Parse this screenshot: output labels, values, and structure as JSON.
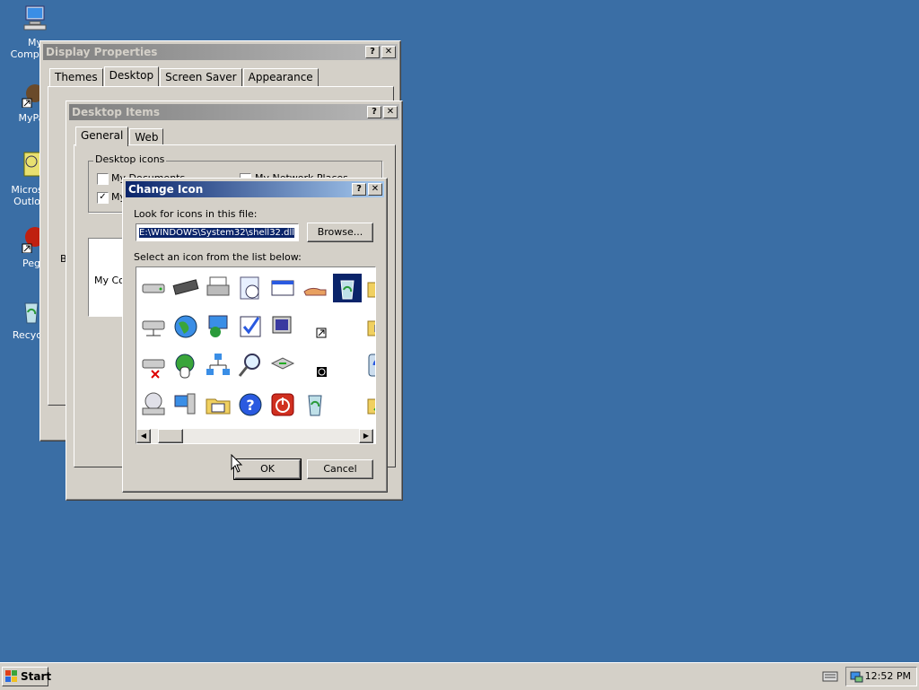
{
  "desktop": {
    "icons": [
      {
        "label": "My Computer",
        "icon": "my-computer-icon"
      },
      {
        "label": "MyPa",
        "icon": "shortcut-icon"
      },
      {
        "label": "Micros Outlo",
        "icon": "outlook-icon"
      },
      {
        "label": "Peg",
        "icon": "pegasus-icon"
      },
      {
        "label": "Recycle",
        "icon": "recycle-bin-icon"
      }
    ]
  },
  "display_properties": {
    "title": "Display Properties",
    "tabs": [
      "Themes",
      "Desktop",
      "Screen Saver",
      "Appearance"
    ],
    "selected_tab": "Desktop",
    "b_label": "B"
  },
  "desktop_items": {
    "title": "Desktop Items",
    "tabs": [
      "General",
      "Web"
    ],
    "selected_tab": "General",
    "group_label": "Desktop icons",
    "checkboxes": [
      {
        "label": "My Documents",
        "checked": false
      },
      {
        "label": "My Network Places",
        "checked": false
      },
      {
        "label": "My",
        "checked": true
      }
    ],
    "preview_label": "My Co"
  },
  "change_icon": {
    "title": "Change Icon",
    "file_label": "Look for icons in this file:",
    "file_value": "E:\\WINDOWS\\System32\\shell32.dll",
    "browse_label": "Browse...",
    "list_label": "Select an icon from the list below:",
    "ok_label": "OK",
    "cancel_label": "Cancel",
    "help_glyph": "?",
    "close_glyph": "✕",
    "icons": [
      "hard-drive-icon",
      "memory-chip-icon",
      "printer-icon",
      "clock-document-icon",
      "window-icon",
      "shared-hand-icon",
      "recycle-bin-full-icon",
      "folder-icon",
      "network-drive-icon",
      "globe-icon",
      "network-computer-icon",
      "checklist-icon",
      "monitor-icon",
      "shortcut-arrow-icon",
      "",
      "folder-network-icon",
      "network-drive-x-icon",
      "mouse-globe-icon",
      "network-icon",
      "search-icon",
      "drive-eject-icon",
      "clock-badge-icon",
      "",
      "refresh-icon",
      "cd-drive-icon",
      "computers-icon",
      "folder-programs-icon",
      "help-icon",
      "shutdown-icon",
      "recycle-bin-icon",
      "",
      "folder-network2-icon"
    ]
  },
  "taskbar": {
    "start_label": "Start",
    "clock": "12:52 PM"
  }
}
